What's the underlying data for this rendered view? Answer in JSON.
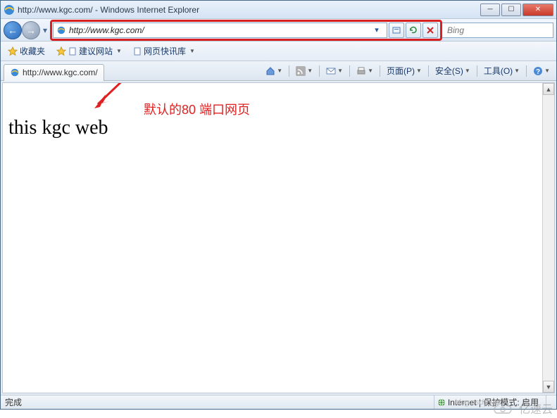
{
  "titlebar": {
    "title": "http://www.kgc.com/ - Windows Internet Explorer"
  },
  "address": {
    "url": "http://www.kgc.com/"
  },
  "search": {
    "placeholder": "Bing"
  },
  "favbar": {
    "favorites_label": "收藏夹",
    "suggested_label": "建议网站",
    "quick_label": "网页快讯库"
  },
  "tab": {
    "title": "http://www.kgc.com/"
  },
  "toolbar": {
    "home_icon": "home",
    "rss_icon": "rss",
    "mail_icon": "mail",
    "print_icon": "print",
    "page_label": "页面(P)",
    "safety_label": "安全(S)",
    "tools_label": "工具(O)",
    "help_icon": "help"
  },
  "page": {
    "body_text": "this kgc web",
    "annotation": "默认的80 端口网页"
  },
  "status": {
    "done": "完成",
    "zone": "Internet | 保护模式: 启用",
    "faint": "blog.csdn.net"
  },
  "watermark": {
    "text": "亿速云"
  }
}
